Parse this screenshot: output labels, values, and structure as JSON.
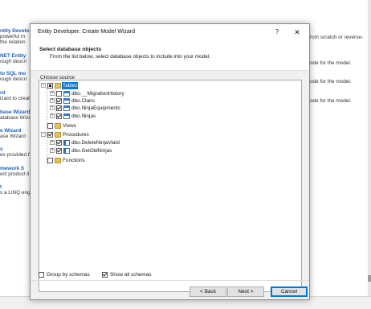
{
  "background": {
    "left_items": [
      {
        "title": "ntity Develo",
        "desc": [
          "powerful m",
          "the relation"
        ]
      },
      {
        "title": "NET Entity",
        "desc": [
          "ough descri"
        ]
      },
      {
        "title": "to SQL mo",
        "desc": [
          "ough descri"
        ]
      },
      {
        "title": "rd",
        "desc": [
          "izard to creat"
        ]
      },
      {
        "title": "base Wizard",
        "desc": [
          "atabase Wiza"
        ]
      },
      {
        "title": "e Wizard",
        "desc": [
          "ase Wizard"
        ]
      },
      {
        "title": "s",
        "desc": [
          "es provided f"
        ]
      },
      {
        "title": "mework S",
        "desc": [
          "ect product li"
        ]
      },
      {
        "title": "t",
        "desc": [
          "s a LINQ eng"
        ]
      }
    ],
    "right_texts": [
      "rom scratch or reverse-",
      "ode for the model.",
      "ode for the model.",
      "ode for the model."
    ]
  },
  "dialog": {
    "title": "Entity Developer: Create Model Wizard",
    "help_label": "?",
    "close_label": "✕",
    "header_title": "Select database objects",
    "header_subtitle": "From the list below, select database objects to include into your model.",
    "choose_label": "Choose source",
    "tree": {
      "tables": {
        "label": "Tables",
        "items": [
          "dbo.__MigrationHistory",
          "dbo.Clans",
          "dbo.NinjaEquipments",
          "dbo.Ninjas"
        ]
      },
      "views": {
        "label": "Views"
      },
      "procedures": {
        "label": "Procedures",
        "items": [
          "dbo.DeleteNinjaViaId",
          "dbo.GetOldNinjas"
        ]
      },
      "functions": {
        "label": "Functions"
      }
    },
    "group_by_schemas_label": "Group by schemas",
    "show_all_schemas_label": "Show all schemas",
    "back_label": "< Back",
    "next_label": "Next >",
    "cancel_label": "Cancel"
  }
}
